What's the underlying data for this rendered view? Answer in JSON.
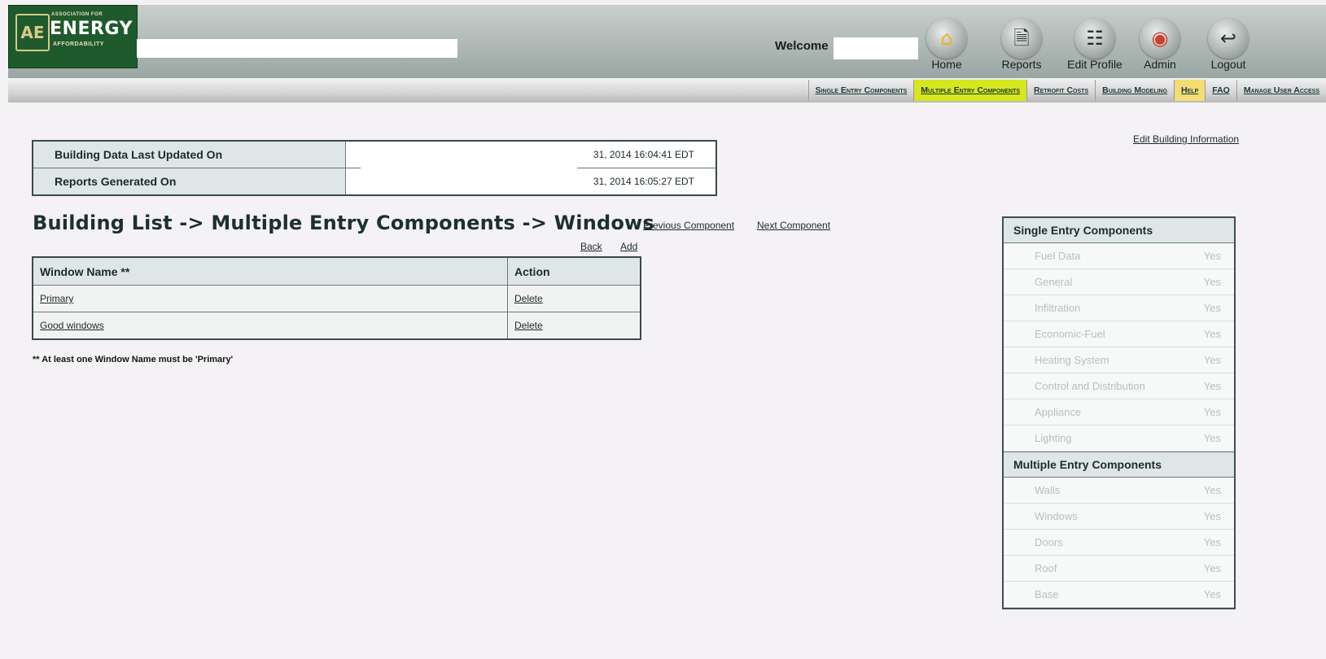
{
  "logo": {
    "line1": "ASSOCIATION FOR",
    "line2": "ENERGY",
    "line3": "AFFORDABILITY"
  },
  "header": {
    "welcome": "Welcome"
  },
  "toolbar": [
    {
      "label": "Home",
      "icon": "home-icon"
    },
    {
      "label": "Reports",
      "icon": "reports-icon"
    },
    {
      "label": "Edit Profile",
      "icon": "edit-profile-icon"
    },
    {
      "label": "Admin",
      "icon": "admin-icon"
    },
    {
      "label": "Logout",
      "icon": "logout-icon"
    }
  ],
  "menu": [
    {
      "label": "Single Entry Components",
      "active": false
    },
    {
      "label": "Multiple Entry Components",
      "active": true
    },
    {
      "label": "Retrofit Costs",
      "active": false
    },
    {
      "label": "Building Modeling",
      "active": false
    },
    {
      "label": "Help",
      "active": false
    },
    {
      "label": "FAQ",
      "active": false
    },
    {
      "label": "Manage User Access",
      "active": false
    }
  ],
  "edit_building": "Edit Building Information",
  "info": [
    {
      "label": "Building Data Last Updated On",
      "value": "31, 2014 16:04:41 EDT"
    },
    {
      "label": "Reports Generated On",
      "value": "31, 2014 16:05:27 EDT"
    }
  ],
  "title": "Building List -> Multiple Entry Components -> Windows",
  "nav": {
    "prev": "Previous Component",
    "next": "Next Component",
    "back": "Back",
    "add": "Add"
  },
  "windows_table": {
    "headers": [
      "Window Name **",
      "Action"
    ],
    "rows": [
      {
        "name": "Primary",
        "action": "Delete"
      },
      {
        "name": "Good windows",
        "action": "Delete"
      }
    ]
  },
  "footnote": "**  At least one Window Name must be 'Primary'",
  "side": {
    "single_title": "Single Entry Components",
    "single": [
      {
        "name": "Fuel Data",
        "status": "Yes"
      },
      {
        "name": "General",
        "status": "Yes"
      },
      {
        "name": "Infiltration",
        "status": "Yes"
      },
      {
        "name": "Economic-Fuel",
        "status": "Yes"
      },
      {
        "name": "Heating System",
        "status": "Yes"
      },
      {
        "name": "Control and Distribution",
        "status": "Yes"
      },
      {
        "name": "Appliance",
        "status": "Yes"
      },
      {
        "name": "Lighting",
        "status": "Yes"
      }
    ],
    "multi_title": "Multiple Entry Components",
    "multi": [
      {
        "name": "Walls",
        "status": "Yes"
      },
      {
        "name": "Windows",
        "status": "Yes"
      },
      {
        "name": "Doors",
        "status": "Yes"
      },
      {
        "name": "Roof",
        "status": "Yes"
      },
      {
        "name": "Base",
        "status": "Yes"
      }
    ]
  }
}
